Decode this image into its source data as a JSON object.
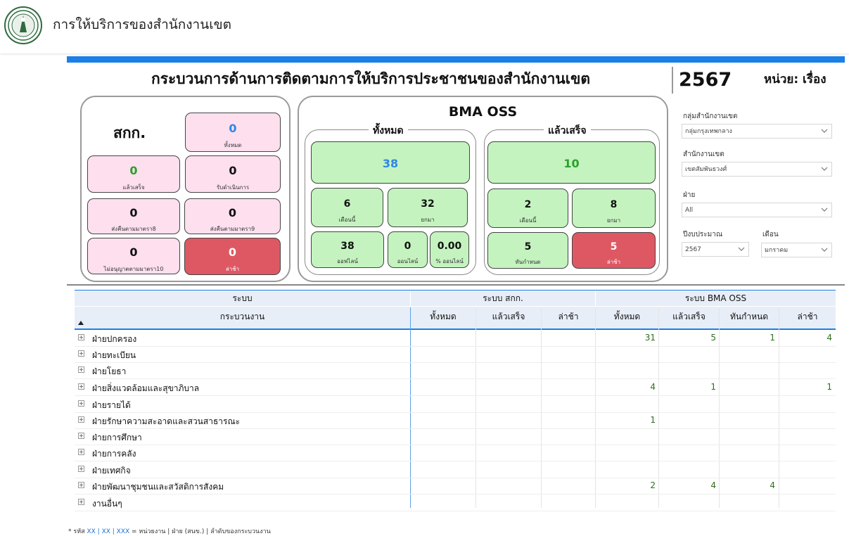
{
  "header": {
    "app_title": "การให้บริการของสำนักงานเขต"
  },
  "report": {
    "title": "กระบวนการด้านการติดตามการให้บริการประชาชนของสำนักงานเขต",
    "year": "2567",
    "unit": "หน่วย: เรื่อง"
  },
  "skk": {
    "title": "สกก.",
    "total": {
      "value": "0",
      "label": "ทั้งหมด"
    },
    "done": {
      "value": "0",
      "label": "แล้วเสร็จ"
    },
    "accepted": {
      "value": "0",
      "label": "รับดำเนินการ"
    },
    "sec8": {
      "value": "0",
      "label": "ส่งคืนตามมาตรา8"
    },
    "sec9": {
      "value": "0",
      "label": "ส่งคืนตามมาตรา9"
    },
    "sec10": {
      "value": "0",
      "label": "ไม่อนุญาตตามมาตรา10"
    },
    "late": {
      "value": "0",
      "label": "ล่าช้า"
    }
  },
  "oss": {
    "title": "BMA OSS",
    "all": {
      "legend": "ทั้งหมด",
      "total": "38",
      "this_month": {
        "value": "6",
        "label": "เดือนนี้"
      },
      "carried": {
        "value": "32",
        "label": "ยกมา"
      },
      "offline": {
        "value": "38",
        "label": "ออฟไลน์"
      },
      "online": {
        "value": "0",
        "label": "ออนไลน์"
      },
      "online_pct": {
        "value": "0.00",
        "label": "% ออนไลน์"
      }
    },
    "done": {
      "legend": "แล้วเสร็จ",
      "total": "10",
      "this_month": {
        "value": "2",
        "label": "เดือนนี้"
      },
      "carried": {
        "value": "8",
        "label": "ยกมา"
      },
      "on_time": {
        "value": "5",
        "label": "ทันกำหนด"
      },
      "late": {
        "value": "5",
        "label": "ล่าช้า"
      }
    }
  },
  "filters": {
    "group": {
      "label": "กลุ่มสำนักงานเขต",
      "value": "กลุ่มกรุงเทพกลาง"
    },
    "district": {
      "label": "สำนักงานเขต",
      "value": "เขตสัมพันธวงศ์"
    },
    "division": {
      "label": "ฝ่าย",
      "value": "All"
    },
    "fiscal_year": {
      "label": "ปีงบประมาณ",
      "value": "2567"
    },
    "month": {
      "label": "เดือน",
      "value": "มกราคม"
    }
  },
  "table": {
    "group_headers": {
      "system": "ระบบ",
      "skk": "ระบบ สกก.",
      "oss": "ระบบ BMA OSS"
    },
    "row_header": "กระบวนงาน",
    "columns": [
      "ทั้งหมด",
      "แล้วเสร็จ",
      "ล่าช้า",
      "ทั้งหมด",
      "แล้วเสร็จ",
      "ทันกำหนด",
      "ล่าช้า"
    ],
    "rows": [
      {
        "name": "ฝ่ายปกครอง",
        "oss_total": "31",
        "oss_done": "5",
        "oss_ontime": "1",
        "oss_late": "4"
      },
      {
        "name": "ฝ่ายทะเบียน",
        "oss_total": "",
        "oss_done": "",
        "oss_ontime": "",
        "oss_late": ""
      },
      {
        "name": "ฝ่ายโยธา",
        "oss_total": "",
        "oss_done": "",
        "oss_ontime": "",
        "oss_late": ""
      },
      {
        "name": "ฝ่ายสิ่งแวดล้อมและสุขาภิบาล",
        "oss_total": "4",
        "oss_done": "1",
        "oss_ontime": "",
        "oss_late": "1"
      },
      {
        "name": "ฝ่ายรายได้",
        "oss_total": "",
        "oss_done": "",
        "oss_ontime": "",
        "oss_late": ""
      },
      {
        "name": "ฝ่ายรักษาความสะอาดและสวนสาธารณะ",
        "oss_total": "1",
        "oss_done": "",
        "oss_ontime": "",
        "oss_late": ""
      },
      {
        "name": "ฝ่ายการศึกษา",
        "oss_total": "",
        "oss_done": "",
        "oss_ontime": "",
        "oss_late": ""
      },
      {
        "name": "ฝ่ายการคลัง",
        "oss_total": "",
        "oss_done": "",
        "oss_ontime": "",
        "oss_late": ""
      },
      {
        "name": "ฝ่ายเทศกิจ",
        "oss_total": "",
        "oss_done": "",
        "oss_ontime": "",
        "oss_late": ""
      },
      {
        "name": "ฝ่ายพัฒนาชุมชนและสวัสดิการสังคม",
        "oss_total": "2",
        "oss_done": "4",
        "oss_ontime": "4",
        "oss_late": ""
      },
      {
        "name": "งานอื่นๆ",
        "oss_total": "",
        "oss_done": "",
        "oss_ontime": "",
        "oss_late": ""
      }
    ]
  },
  "footnote": {
    "prefix": "* รหัส ",
    "code": "XX | XX | XXX",
    "suffix": " = หน่วยงาน | ฝ่าย (สนข.) | ลำดับของกระบวนงาน"
  },
  "colors": {
    "accent": "#1a7fe6",
    "pink": "#fddfee",
    "green": "#c4f3bf",
    "red": "#de5864",
    "blue_value": "#2f86e6",
    "green_value": "#2aa02a"
  }
}
